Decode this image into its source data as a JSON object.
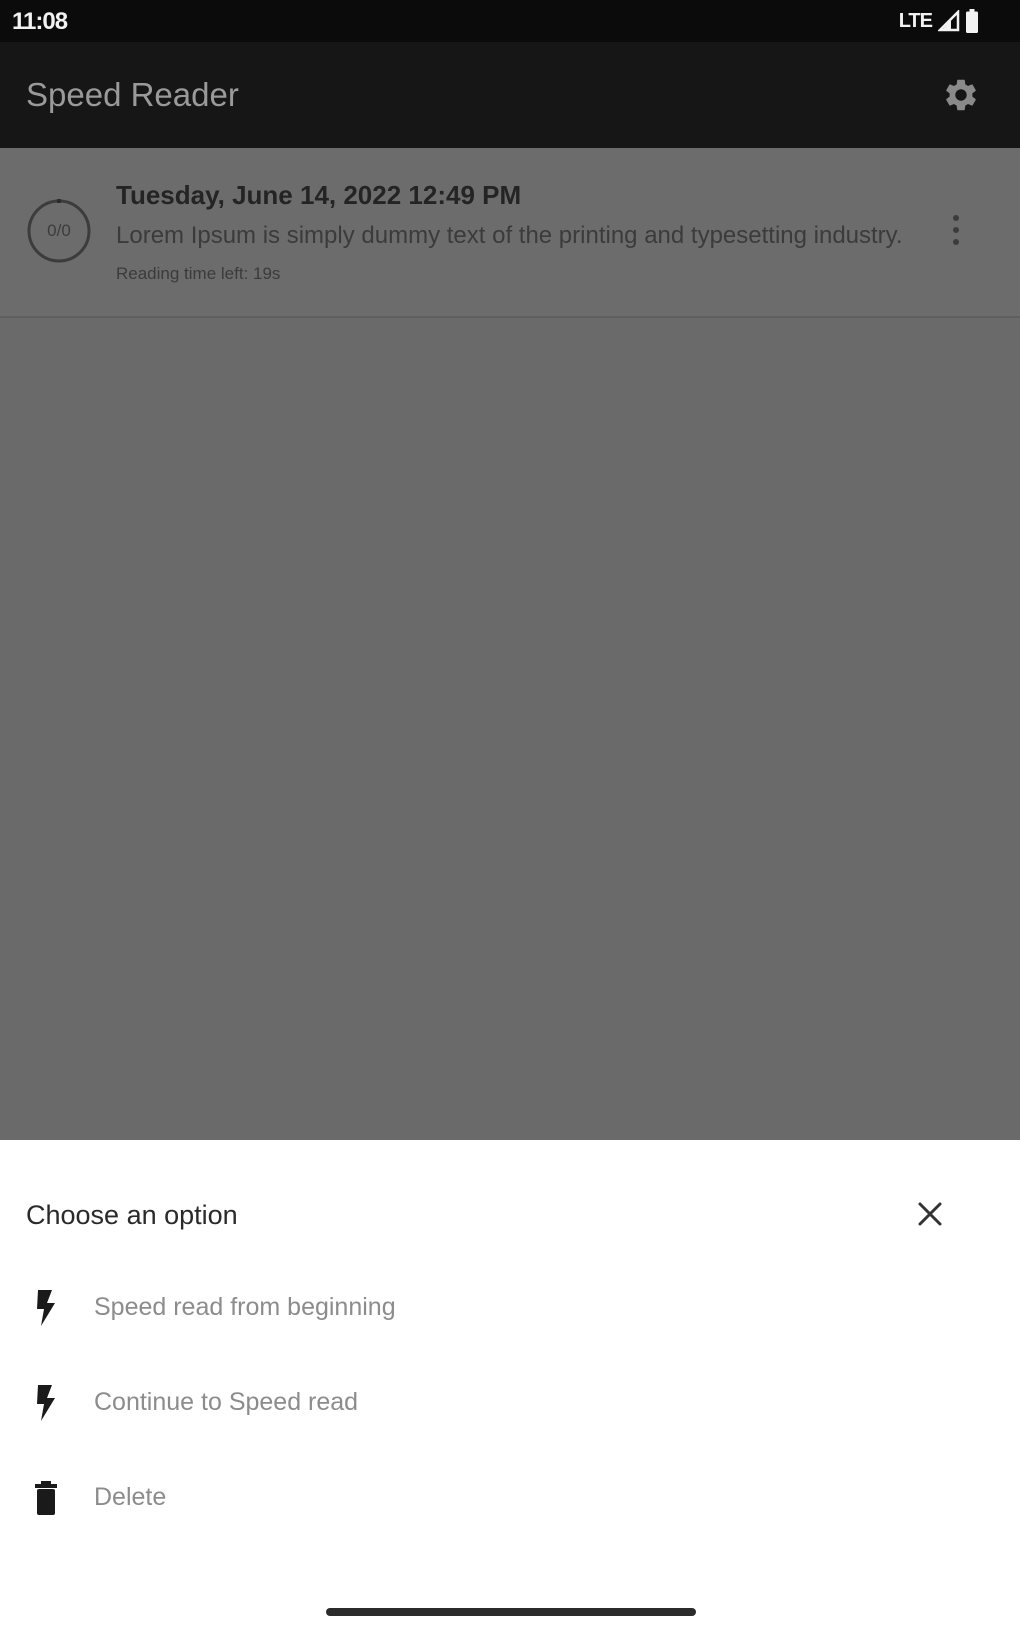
{
  "status_bar": {
    "time": "11:08",
    "network": "LTE",
    "icons": [
      "signal-icon",
      "battery-icon"
    ]
  },
  "app_bar": {
    "title": "Speed Reader",
    "settings_icon": "gear-icon"
  },
  "list": {
    "items": [
      {
        "title": "Tuesday, June 14, 2022 12:49 PM",
        "preview": "Lorem Ipsum is simply dummy text of the printing and typesetting industry.",
        "time_left": "Reading time left: 19s",
        "progress_label": "0/0",
        "progress": 0.02,
        "more_icon": "more-vert-icon"
      }
    ]
  },
  "bottom_sheet": {
    "title": "Choose an option",
    "close_icon": "close-icon",
    "options": [
      {
        "label": "Speed read from beginning",
        "icon": "bolt-icon"
      },
      {
        "label": "Continue to Speed read",
        "icon": "bolt-icon"
      },
      {
        "label": "Delete",
        "icon": "trash-icon"
      }
    ]
  },
  "colors": {
    "status_bar_bg": "#0b0b0b",
    "app_bar_bg": "#161616",
    "scrim_bg": "#6a6a6a",
    "sheet_bg": "#ffffff",
    "option_text": "#8c8c8c"
  }
}
